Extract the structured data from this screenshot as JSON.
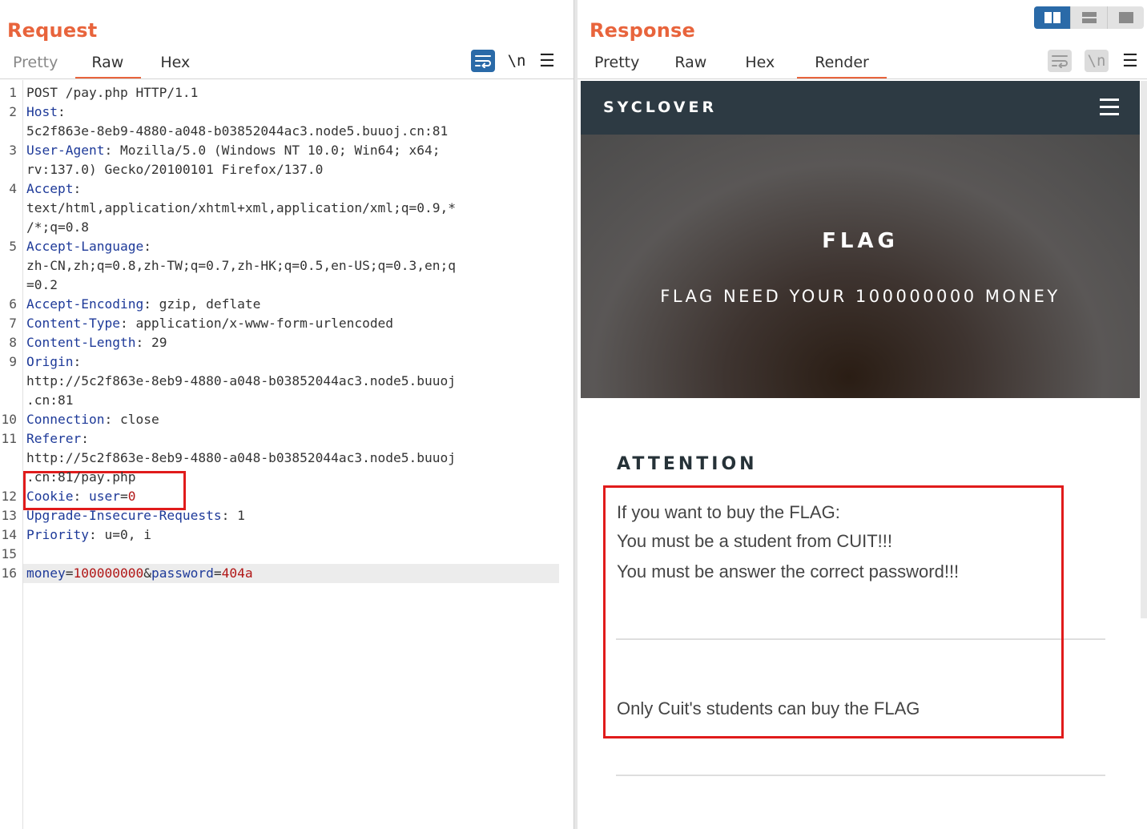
{
  "request": {
    "title": "Request",
    "tabs": [
      "Pretty",
      "Raw",
      "Hex"
    ],
    "active_tab": "Raw",
    "toolbar": {
      "wrap_icon": "wrap-lines-icon",
      "newline_label": "\\n",
      "menu_icon": "hamburger-menu-icon"
    },
    "lines": [
      {
        "n": "1",
        "parts": [
          [
            "t",
            "POST /pay.php HTTP/1.1"
          ]
        ]
      },
      {
        "n": "2",
        "parts": [
          [
            "k",
            "Host"
          ],
          [
            "t",
            ":"
          ]
        ]
      },
      {
        "n": "",
        "parts": [
          [
            "t",
            "5c2f863e-8eb9-4880-a048-b03852044ac3.node5.buuoj.cn:81"
          ]
        ]
      },
      {
        "n": "3",
        "parts": [
          [
            "k",
            "User-Agent"
          ],
          [
            "t",
            ": Mozilla/5.0 (Windows NT 10.0; Win64; x64;"
          ]
        ]
      },
      {
        "n": "",
        "parts": [
          [
            "t",
            "rv:137.0) Gecko/20100101 Firefox/137.0"
          ]
        ]
      },
      {
        "n": "4",
        "parts": [
          [
            "k",
            "Accept"
          ],
          [
            "t",
            ":"
          ]
        ]
      },
      {
        "n": "",
        "parts": [
          [
            "t",
            "text/html,application/xhtml+xml,application/xml;q=0.9,*"
          ]
        ]
      },
      {
        "n": "",
        "parts": [
          [
            "t",
            "/*;q=0.8"
          ]
        ]
      },
      {
        "n": "5",
        "parts": [
          [
            "k",
            "Accept-Language"
          ],
          [
            "t",
            ":"
          ]
        ]
      },
      {
        "n": "",
        "parts": [
          [
            "t",
            "zh-CN,zh;q=0.8,zh-TW;q=0.7,zh-HK;q=0.5,en-US;q=0.3,en;q"
          ]
        ]
      },
      {
        "n": "",
        "parts": [
          [
            "t",
            "=0.2"
          ]
        ]
      },
      {
        "n": "6",
        "parts": [
          [
            "k",
            "Accept-Encoding"
          ],
          [
            "t",
            ": gzip, deflate"
          ]
        ]
      },
      {
        "n": "7",
        "parts": [
          [
            "k",
            "Content-Type"
          ],
          [
            "t",
            ": application/x-www-form-urlencoded"
          ]
        ]
      },
      {
        "n": "8",
        "parts": [
          [
            "k",
            "Content-Length"
          ],
          [
            "t",
            ": 29"
          ]
        ]
      },
      {
        "n": "9",
        "parts": [
          [
            "k",
            "Origin"
          ],
          [
            "t",
            ":"
          ]
        ]
      },
      {
        "n": "",
        "parts": [
          [
            "t",
            "http://5c2f863e-8eb9-4880-a048-b03852044ac3.node5.buuoj"
          ]
        ]
      },
      {
        "n": "",
        "parts": [
          [
            "t",
            ".cn:81"
          ]
        ]
      },
      {
        "n": "10",
        "parts": [
          [
            "k",
            "Connection"
          ],
          [
            "t",
            ": close"
          ]
        ]
      },
      {
        "n": "11",
        "parts": [
          [
            "k",
            "Referer"
          ],
          [
            "t",
            ":"
          ]
        ]
      },
      {
        "n": "",
        "parts": [
          [
            "t",
            "http://5c2f863e-8eb9-4880-a048-b03852044ac3.node5.buuoj"
          ]
        ]
      },
      {
        "n": "",
        "parts": [
          [
            "t",
            ".cn:81/pay.php"
          ]
        ]
      },
      {
        "n": "12",
        "parts": [
          [
            "k",
            "Cookie"
          ],
          [
            "t",
            ": "
          ],
          [
            "k",
            "user"
          ],
          [
            "t",
            "="
          ],
          [
            "v",
            "0"
          ]
        ]
      },
      {
        "n": "13",
        "parts": [
          [
            "k",
            "Upgrade-Insecure-Requests"
          ],
          [
            "t",
            ": 1"
          ]
        ]
      },
      {
        "n": "14",
        "parts": [
          [
            "k",
            "Priority"
          ],
          [
            "t",
            ": u=0, i"
          ]
        ]
      },
      {
        "n": "15",
        "parts": []
      },
      {
        "n": "16",
        "parts": [
          [
            "k",
            "money"
          ],
          [
            "t",
            "="
          ],
          [
            "v",
            "100000000"
          ],
          [
            "t",
            "&"
          ],
          [
            "k",
            "password"
          ],
          [
            "t",
            "="
          ],
          [
            "v",
            "404a"
          ]
        ]
      }
    ]
  },
  "response": {
    "title": "Response",
    "tabs": [
      "Pretty",
      "Raw",
      "Hex",
      "Render"
    ],
    "active_tab": "Render",
    "toolbar": {
      "wrap_icon": "wrap-lines-icon",
      "newline_label": "\\n",
      "menu_icon": "hamburger-menu-icon"
    },
    "layout_toggle": [
      "split-columns-icon",
      "split-rows-icon",
      "single-pane-icon"
    ],
    "page": {
      "brand": "SYCLOVER",
      "hero_title": "FLAG",
      "hero_subtitle": "FLAG NEED YOUR 100000000 MONEY",
      "attention_title": "ATTENTION",
      "attention_lines": [
        "If you want to buy the FLAG:",
        "You must be a student from CUIT!!!",
        "You must be answer the correct password!!!"
      ],
      "note": "Only Cuit's students can buy the FLAG"
    }
  },
  "colors": {
    "accent": "#e8643c",
    "key": "#1e3a99",
    "value": "#b11717",
    "highlight_box": "#e01b1b",
    "nav_bg": "#2d3a43",
    "toggle_active": "#2a6aa8"
  }
}
